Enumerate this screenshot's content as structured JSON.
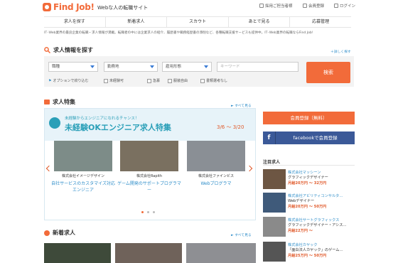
{
  "header": {
    "logo": "Find Job!",
    "tagline": "Webな人の転職サイト",
    "links": [
      "採用ご担当者様",
      "会員登録",
      "ログイン"
    ]
  },
  "nav": [
    "求人を探す",
    "新着求人",
    "スカウト",
    "あとで見る",
    "応募管理"
  ],
  "intro": "IT･Web業界の最良企業の転職・求人情報が満載。転職者の中には企業求人の紹介、履歴書や職務経歴書の添削など、各種転職支援サービスも提供中。IT･Web業界の転職ならFind Job!",
  "search": {
    "title": "求人情報を探す",
    "detail_link": "＋詳しく探す",
    "selects": [
      "職種",
      "勤務地",
      "雇用形態"
    ],
    "keyword_placeholder": "キーワード",
    "button": "検索",
    "checkbox_header": "オプションで絞り込む",
    "options": [
      "未経験可",
      "急募",
      "服装自由",
      "書類選考なし"
    ]
  },
  "features": {
    "title": "求人特集",
    "more": "► すべて見る",
    "catch": "未経験からエンジニアになれるチャンス！",
    "headline": "未経験OKエンジニア求人特集",
    "period": "3/6 〜 3/20",
    "cards": [
      {
        "company": "株式会社イメージデザイン",
        "desc": "自社サービスのカスタマイズ対応エンジニア"
      },
      {
        "company": "株式会社Rapith",
        "desc": "ゲーム開発のサポートプログラマー"
      },
      {
        "company": "株式会社ファインビス",
        "desc": "Webプログラマ"
      }
    ]
  },
  "new_jobs": {
    "title": "新着求人",
    "more": "► すべて見る"
  },
  "sidebar": {
    "register": "会員登録（無料）",
    "facebook": "facebookで会員登録",
    "featured_title": "注目求人",
    "jobs": [
      {
        "company": "株式会社マッシーン",
        "title": "グラフィックデザイナー",
        "salary": "月給20万円 〜 32万円"
      },
      {
        "company": "株式会社アビリティコンサルタ…",
        "title": "Webデザイナー",
        "salary": "月給20万円 〜 50万円"
      },
      {
        "company": "株式会社サートグラフィックス",
        "title": "グラフィックデザイナー・アシス…",
        "salary": "月給22万円 〜"
      },
      {
        "company": "株式会社カヤック",
        "title": "「面白法人カヤック」のゲーム…",
        "salary": "月給25万円 〜 50万円"
      }
    ]
  },
  "colors": {
    "accent": "#f26b3a",
    "link": "#2e8dc9",
    "facebook": "#3b5998",
    "teal": "#2a9fb8"
  }
}
